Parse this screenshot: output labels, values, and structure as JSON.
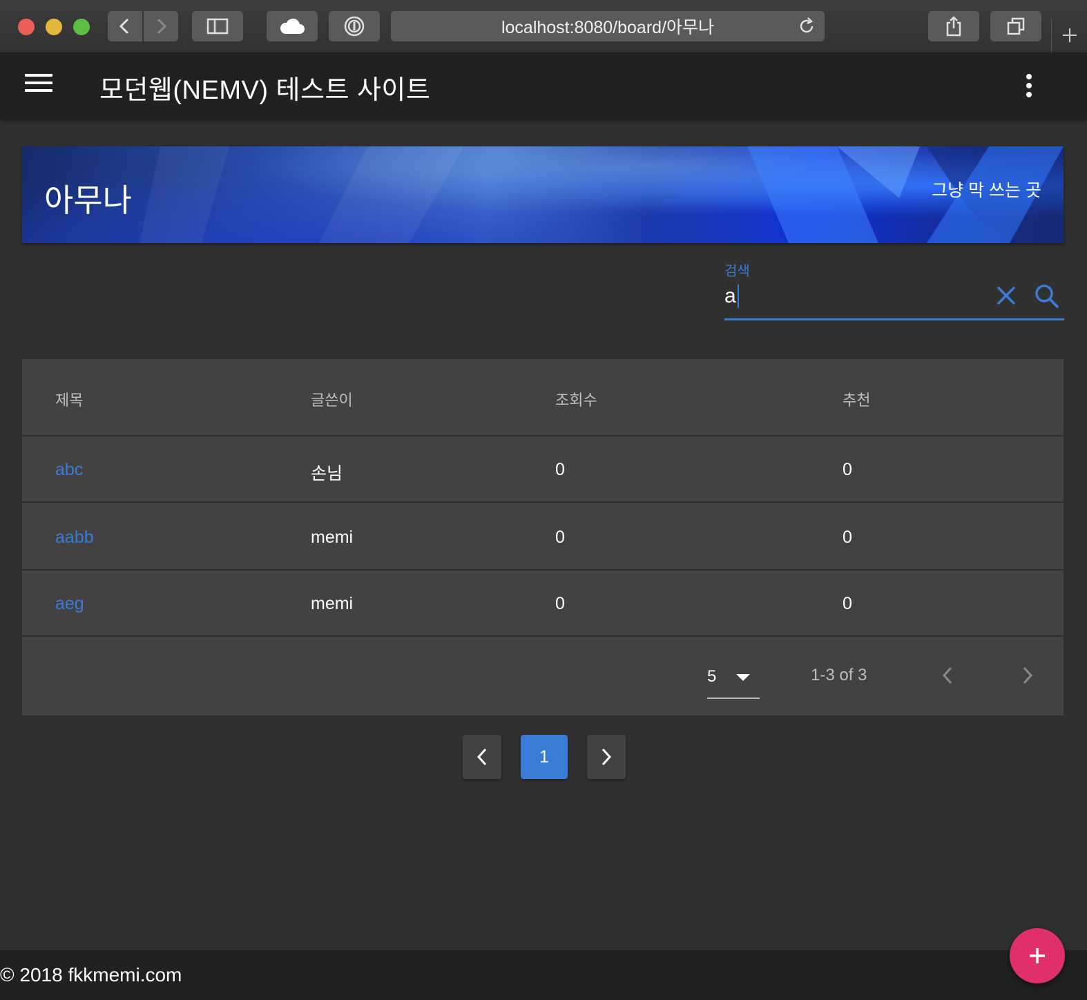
{
  "browser": {
    "url": "localhost:8080/board/아무나",
    "icons": [
      "back-icon",
      "forward-icon",
      "sidebar-icon",
      "cloud-icon",
      "password-icon",
      "reload-icon",
      "share-icon",
      "tabs-icon",
      "new-tab-icon"
    ]
  },
  "app": {
    "title": "모던웹(NEMV) 테스트 사이트",
    "icons": [
      "menu-icon",
      "more-vert-icon"
    ]
  },
  "banner": {
    "title": "아무나",
    "subtitle": "그냥 막 쓰는 곳"
  },
  "search": {
    "label": "검색",
    "value": "a"
  },
  "table": {
    "headers": [
      "제목",
      "글쓴이",
      "조회수",
      "추천"
    ],
    "rows": [
      {
        "title": "abc",
        "author": "손님",
        "views": "0",
        "likes": "0"
      },
      {
        "title": "aabb",
        "author": "memi",
        "views": "0",
        "likes": "0"
      },
      {
        "title": "aeg",
        "author": "memi",
        "views": "0",
        "likes": "0"
      }
    ],
    "rows_per_page": "5",
    "range_text": "1-3 of 3"
  },
  "pagination": {
    "current_page": "1"
  },
  "footer": {
    "text": "© 2018 fkkmemi.com"
  },
  "colors": {
    "accent": "#3a7bd5",
    "fab": "#e0306b",
    "background": "#303030",
    "toolbar": "#212121",
    "card": "#424242"
  }
}
